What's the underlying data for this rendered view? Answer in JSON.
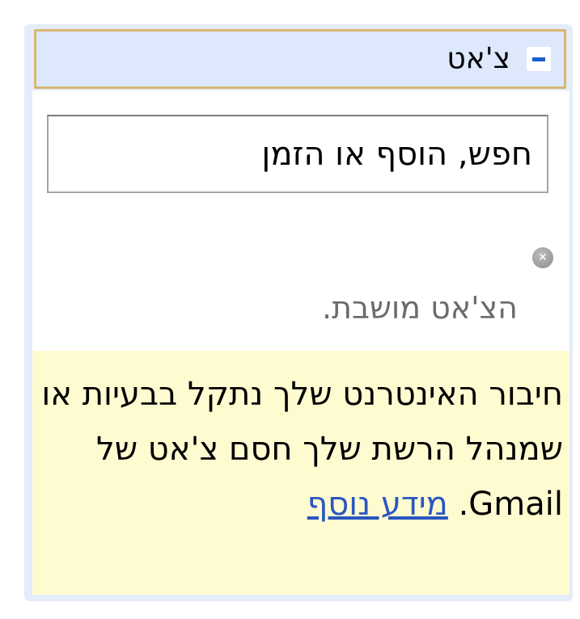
{
  "chat_panel": {
    "title": "צ'אט",
    "search": {
      "placeholder": "חפש, הוסף או הזמן"
    },
    "status_text": "הצ'אט מושבת.",
    "warning": {
      "text": "חיבור האינטרנט שלך נתקל בבעיות או שמנהל הרשת שלך חסם צ'אט של Gmail. ",
      "link_text": "מידע נוסף"
    }
  },
  "icons": {
    "collapse": "minus-icon",
    "close": "close-icon"
  },
  "colors": {
    "panel_bg": "#e4ecf9",
    "header_bg": "#dde8fc",
    "header_border": "#d9b673",
    "accent_blue": "#1a5ed0",
    "warning_bg": "#fffbd0",
    "link": "#2a56c2",
    "status_text": "#6b6b6b"
  }
}
